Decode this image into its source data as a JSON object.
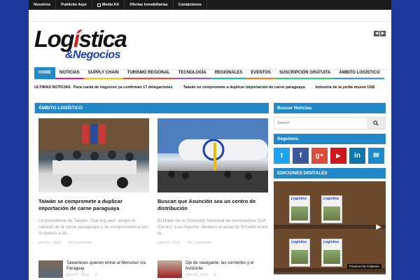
{
  "topbar": {
    "items": [
      "Nosotros",
      "Publicite Aquí",
      "Media Kit",
      "Ofertas Inmobiliarias",
      "Contáctenos"
    ]
  },
  "header": {
    "logo_line1": "Logística",
    "logo_line2": "&Negocios",
    "prev": "◀",
    "next": "▶"
  },
  "nav": {
    "items": [
      "HOME",
      "NOTICIAS",
      "SUPPLY CHAIN",
      "TURISMO REGIONAL",
      "TECNOLOGÍA",
      "REGIONALES",
      "EVENTOS",
      "SUSCRIPCIÓN GRATUITA",
      "ÁMBITO LOGÍSTICO"
    ],
    "colors": [
      "#2189c8",
      "#e0218a",
      "#f1c40f",
      "#e74c3c",
      "#9b59b6",
      "#1abc9c",
      "#e67e22",
      "#2ecc71",
      "#3498db"
    ]
  },
  "ticker": {
    "label": "ULTIMAS NOTICIAS",
    "items": [
      "Para rueda de negocios ya confirman 17 delegaciones",
      "Taiwán se compromete a duplicar importación de carne paraguaya",
      "Industria de la yerba mueve US$"
    ]
  },
  "main": {
    "section_title": "ÁMBITO LOGÍSTICO",
    "cards": [
      {
        "title": "Taiwán se compromete a duplicar importación de carne paraguaya",
        "excerpt": "La presidenta de Taiwán, Tsai Ing-wen, elogió la calidad de la carne paraguaya y se comprometió a por lo menos a du...",
        "date": "julio 01, 2016",
        "comments": "00 Comments"
      },
      {
        "title": "Buscan que Asunción sea un centro de distribución",
        "excerpt": "El titular de la Dirección Nacional de Aeronáutica Civil (Dinac), Luis Aguirre, destacó el acuerdo firmado entre la...",
        "date": "julio 01, 2016",
        "comments": "00 Comments"
      }
    ],
    "small": [
      {
        "title": "Taiwaneses quieren entrar al Mercosur vía Paraguay",
        "date": "julio 01, 2016",
        "count": "0"
      },
      {
        "title": "Ojo de navegante: las corrientes y el horizonte",
        "date": "julio 06, 2016",
        "count": "0"
      }
    ]
  },
  "sidebar": {
    "search_title": "Buscar Noticias",
    "search_placeholder": "Search",
    "social_title": "Seguinos:",
    "social": [
      {
        "name": "twitter",
        "glyph": "t",
        "color": "#1da1f2"
      },
      {
        "name": "facebook",
        "glyph": "f",
        "color": "#3b5998"
      },
      {
        "name": "google-plus",
        "glyph": "g+",
        "color": "#dd4b39"
      },
      {
        "name": "youtube",
        "glyph": "▶",
        "color": "#cc181e"
      },
      {
        "name": "linkedin",
        "glyph": "in",
        "color": "#0e76a8"
      },
      {
        "name": "email",
        "glyph": "✉",
        "color": "#2189c8"
      }
    ],
    "editions_title": "EDICIONES DIGITALES",
    "mag_label": "Logística",
    "powered": "Powered by Calaméo"
  }
}
